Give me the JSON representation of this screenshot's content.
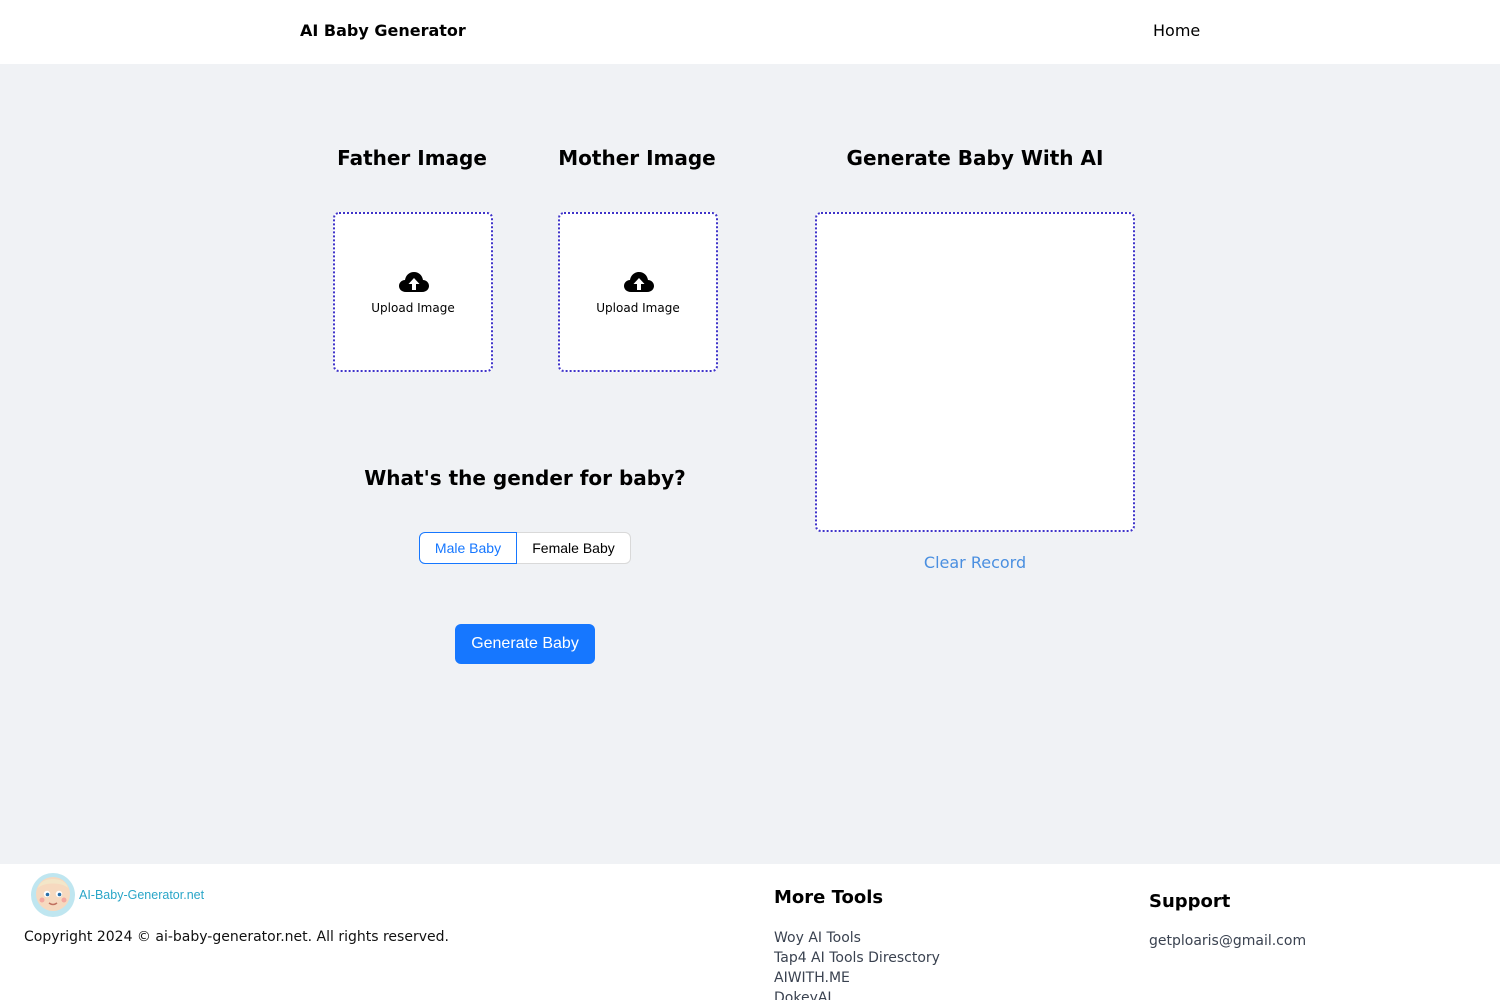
{
  "header": {
    "brand": "AI Baby Generator",
    "nav_home": "Home"
  },
  "father": {
    "title": "Father Image",
    "upload_label": "Upload Image",
    "icon": "cloud-upload-icon"
  },
  "mother": {
    "title": "Mother Image",
    "upload_label": "Upload Image",
    "icon": "cloud-upload-icon"
  },
  "result": {
    "title": "Generate Baby With AI",
    "clear_label": "Clear Record"
  },
  "gender": {
    "question": "What's the gender for baby?",
    "options": [
      "Male Baby",
      "Female Baby"
    ],
    "selected": "Male Baby"
  },
  "generate_button": "Generate Baby",
  "footer": {
    "logo_text": "AI-Baby-Generator.net",
    "copyright": "Copyright 2024 © ai-baby-generator.net. All rights reserved.",
    "more_tools_title": "More Tools",
    "tools": [
      "Woy AI Tools",
      "Tap4 AI Tools Diresctory",
      "AIWITH.ME",
      "DokeyAI"
    ],
    "support_title": "Support",
    "support_email": "getploaris@gmail.com"
  },
  "colors": {
    "primary": "#1677ff",
    "dotted_border": "#3f33c9",
    "link": "#4a8fe0",
    "page_background": "#f0f2f5"
  }
}
